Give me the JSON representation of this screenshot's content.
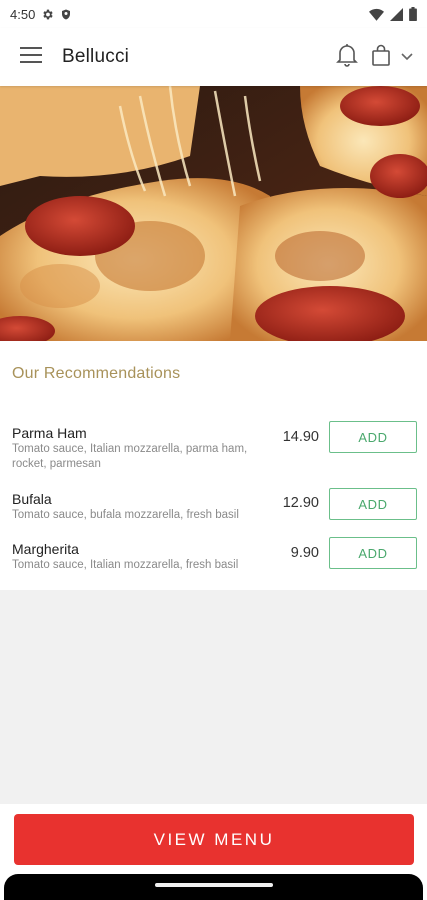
{
  "status_bar": {
    "time": "4:50"
  },
  "header": {
    "title": "Bellucci",
    "icons": [
      "menu-icon",
      "bell-icon",
      "shopping-bag-icon",
      "chevron-down-icon"
    ]
  },
  "hero": {
    "image": "pepperoni pizza"
  },
  "recommendations": {
    "title": "Our Recommendations",
    "add_label": "ADD",
    "items": [
      {
        "name": "Parma Ham",
        "description": "Tomato sauce, Italian mozzarella, parma ham, rocket, parmesan",
        "price": "14.90"
      },
      {
        "name": "Bufala",
        "description": "Tomato sauce, bufala mozzarella, fresh basil",
        "price": "12.90"
      },
      {
        "name": "Margherita",
        "description": "Tomato sauce, Italian mozzarella, fresh basil",
        "price": "9.90"
      }
    ]
  },
  "footer": {
    "button_label": "VIEW MENU"
  },
  "colors": {
    "accent": "#e8322f",
    "add_border": "#6bbf8a",
    "section_title": "#a8925a"
  }
}
